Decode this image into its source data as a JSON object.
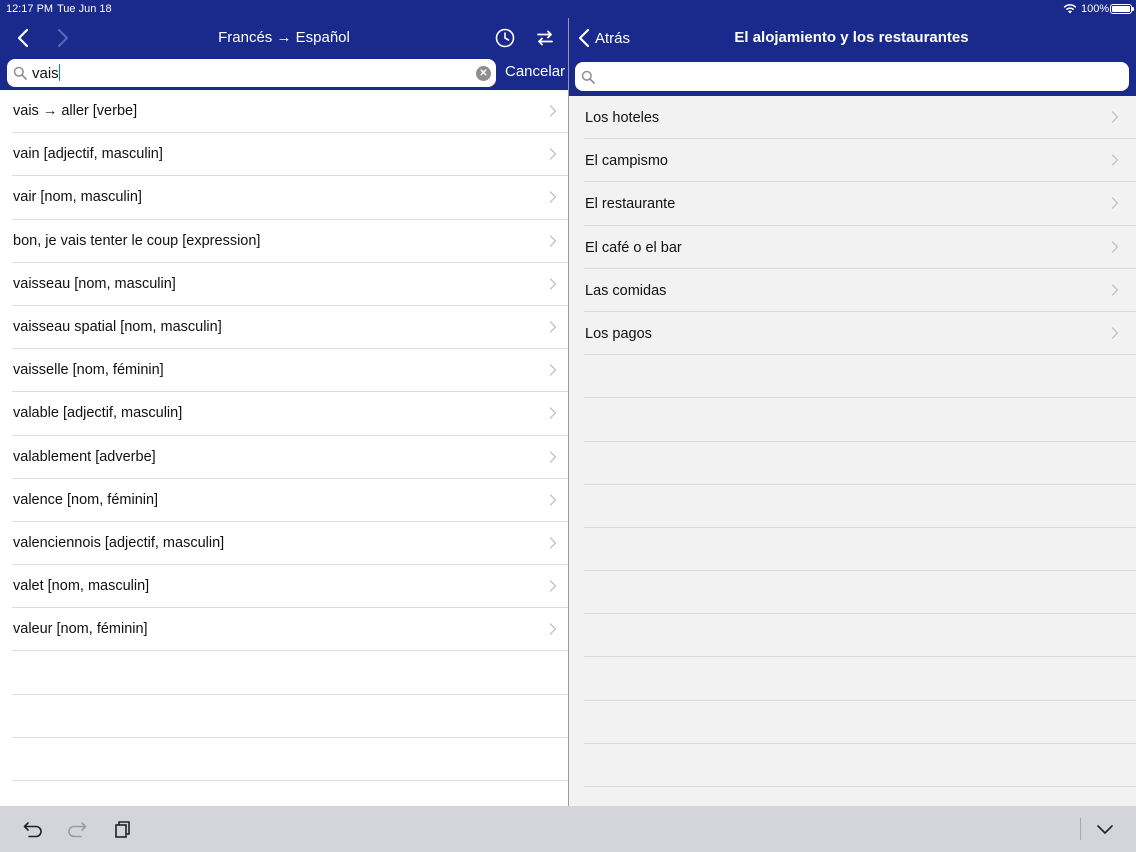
{
  "status_bar": {
    "time": "12:17 PM",
    "date": "Tue Jun 18",
    "battery_text": "100%",
    "battery_level": 1.0
  },
  "left_pane": {
    "title": "Francés → Español",
    "search": {
      "value": "vais",
      "placeholder": ""
    },
    "cancel_label": "Cancelar",
    "results": [
      "vais → aller [verbe]",
      "vain [adjectif, masculin]",
      "vair [nom, masculin]",
      "bon, je vais tenter le coup [expression]",
      "vaisseau [nom, masculin]",
      "vaisseau spatial [nom, masculin]",
      "vaisselle [nom, féminin]",
      "valable [adjectif, masculin]",
      "valablement [adverbe]",
      "valence [nom, féminin]",
      "valenciennois [adjectif, masculin]",
      "valet [nom, masculin]",
      "valeur [nom, féminin]"
    ]
  },
  "right_pane": {
    "back_label": "Atrás",
    "title": "El alojamiento y los restaurantes",
    "search": {
      "value": "",
      "placeholder": ""
    },
    "topics": [
      "Los hoteles",
      "El campismo",
      "El restaurante",
      "El café o el bar",
      "Las comidas",
      "Los pagos"
    ]
  },
  "colors": {
    "header_blue": "#192a8c",
    "toolbar_gray": "#d3d5da"
  },
  "icons": {
    "nav_back": "chevron-left-icon",
    "nav_forward": "chevron-right-icon",
    "history": "clock-icon",
    "swap": "swap-arrows-icon",
    "undo": "undo-icon",
    "redo": "redo-icon",
    "clipboard": "clipboard-icon",
    "keyboard_dismiss": "chevron-down-icon"
  }
}
